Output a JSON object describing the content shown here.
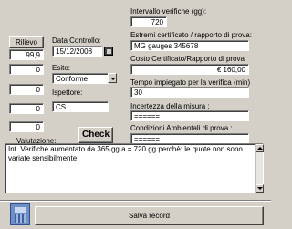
{
  "left_column": {
    "rilievo_label": "Rilievo",
    "rows": [
      "99,9",
      "0",
      "0",
      "0",
      "0"
    ]
  },
  "data_controllo": {
    "label": "Data Controllo:",
    "value": "15/12/2008"
  },
  "esito": {
    "label": "Esito:",
    "value": "Conforme"
  },
  "ispettore": {
    "label": "Ispettore:",
    "value": "CS"
  },
  "check_button": {
    "label": "Check"
  },
  "valutazione": {
    "label": "Valutazione:",
    "text": "Int. Verifiche aumentato da 365 gg  a = 720 gg  perchè: le quote non sono variate sensibilmente"
  },
  "intervallo": {
    "label": "Intervallo verifiche (gg):",
    "value": "720"
  },
  "estremi": {
    "label": "Estremi certificato / rapporto di prova:",
    "value": "MG gauges  345678"
  },
  "costo": {
    "label": "Costo Certificato/Rapporto di prova",
    "value": "€ 160,00"
  },
  "tempo": {
    "label": "Tempo impiegato per la verifica (min)",
    "value": "30"
  },
  "incertezza": {
    "label": "Incertezza della misura :",
    "value": "======"
  },
  "condizioni": {
    "label": "Condizioni Ambientali di prova :",
    "value": "======"
  },
  "save_button": {
    "label": "Salva record"
  },
  "colors": {
    "background": "#d4d0c8",
    "field": "#ffffff",
    "icon": "#6f8fc4"
  }
}
